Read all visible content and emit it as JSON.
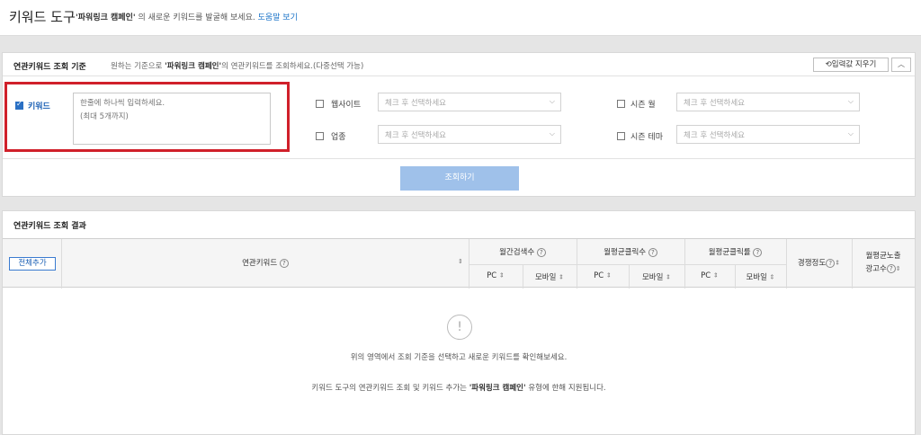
{
  "topbar": {
    "title": "키워드 도구",
    "campaign": "'파워링크 캠페인'",
    "desc": "의 새로운 키워드를 발굴해 보세요.",
    "help": "도움말 보기"
  },
  "criteria": {
    "title": "연관키워드 조회 기준",
    "desc_pre": "원하는 기준으로",
    "desc_campaign": "'파워링크 캠페인'",
    "desc_post": "의 연관키워드를 조회하세요.(다중선택 가능)",
    "reset_label": "입력값 지우기",
    "keyword_label": "키워드",
    "keyword_placeholder": "한줄에 하나씩 입력하세요.\n(최대 5개까지)",
    "website_label": "웹사이트",
    "industry_label": "업종",
    "season_month_label": "시즌 월",
    "season_theme_label": "시즌 테마",
    "select_placeholder": "체크 후 선택하세요",
    "search_label": "조회하기"
  },
  "results": {
    "title": "연관키워드 조회 결과",
    "add_all_label": "전체추가",
    "columns": {
      "keyword": "연관키워드",
      "monthly_search": "월간검색수",
      "avg_clicks": "월평균클릭수",
      "avg_ctr": "월평균클릭률",
      "competition": "경쟁정도",
      "avg_ads_line1": "월평균노출",
      "avg_ads_line2": "광고수",
      "pc": "PC",
      "mobile": "모바일"
    },
    "empty_msg1": "위의 영역에서 조회 기준을 선택하고 새로운 키워드를 확인해보세요.",
    "empty_msg2_pre": "키워드 도구의 연관키워드 조회 및 키워드 추가는",
    "empty_msg2_campaign": "'파워링크 캠페인'",
    "empty_msg2_post": "유형에 한해 지원됩니다."
  },
  "icons": {
    "help": "question-circle-icon",
    "sort": "sort-icon",
    "reset": "refresh-icon",
    "collapse": "chevron-up-icon",
    "empty": "exclamation-circle-icon"
  },
  "colors": {
    "highlight": "#d0202a",
    "accent": "#2a70c4",
    "search_button": "#9fc1ea"
  }
}
